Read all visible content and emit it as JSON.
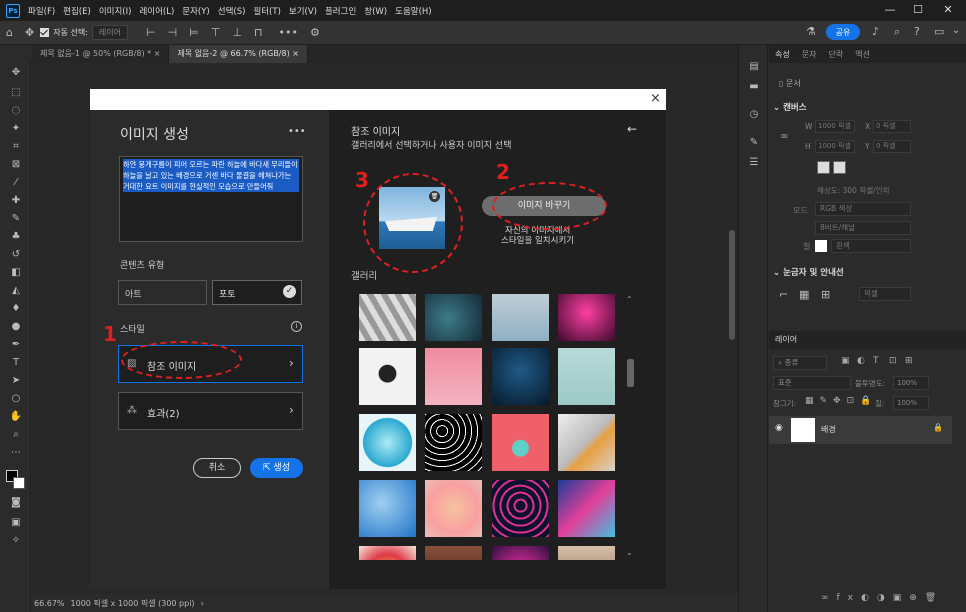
{
  "menu": {
    "app_icon": "Ps",
    "items": [
      "파일(F)",
      "편집(E)",
      "이미지(I)",
      "레이어(L)",
      "문자(Y)",
      "선택(S)",
      "필터(T)",
      "보기(V)",
      "플러그인",
      "창(W)",
      "도움말(H)"
    ]
  },
  "window_controls": {
    "minimize": "—",
    "maximize": "☐",
    "close": "✕"
  },
  "options": {
    "auto_select_label": "자동 선택:",
    "auto_select_value": "레이어",
    "more": "•••",
    "share": "공유"
  },
  "doc_tabs": [
    {
      "label": "제목 없음-1 @ 50% (RGB/8) *",
      "close": "×"
    },
    {
      "label": "제목 없음-2 @ 66.7% (RGB/8)",
      "close": "×"
    }
  ],
  "status": {
    "zoom": "66.67%",
    "info": "1000 픽셀 x 1000 픽셀 (300 ppi)",
    "arrow": "›"
  },
  "properties_panel": {
    "tabs": [
      "속성",
      "문자",
      "단락",
      "액션"
    ],
    "doc_label": "문서",
    "canvas_section": "캔버스",
    "w_label": "W",
    "w_value": "1000 픽셀",
    "h_label": "H",
    "h_value": "1000 픽셀",
    "x_label": "X",
    "x_value": "0 픽셀",
    "y_label": "Y",
    "y_value": "0 픽셀",
    "resolution": "해상도: 300 픽셀/인치",
    "mode_label": "모드",
    "mode_value": "RGB 색상",
    "depth_value": "8비트/채널",
    "fill_label": "칠",
    "fill_value": "흰색",
    "rulers_section": "눈금자 및 안내선",
    "units_value": "픽셀"
  },
  "layers_panel": {
    "title": "레이어",
    "kind": "종류",
    "blend": "표준",
    "opacity_label": "불투명도:",
    "opacity_value": "100%",
    "lock_label": "잠그기:",
    "fill_label": "칠:",
    "fill_value": "100%",
    "layer_name": "배경"
  },
  "dialog": {
    "close": "×",
    "title": "이미지 생성",
    "menu": "•••",
    "prompt": "하얀 뭉게구름이 피어 오르는 파란 하늘에 바다새 무리들이 하늘을 날고 있는 배경으로 거센 바다 물결을 헤쳐나가는 거대한 요트 이미지를 현실적인 모습으로 만들어줘",
    "content_type_label": "콘텐츠 유형",
    "type_art": "아트",
    "type_photo": "포토",
    "style_label": "스타일",
    "info": "i",
    "ref_image_btn": "참조 이미지",
    "effects_btn": "효과(2)",
    "cancel": "취소",
    "generate": "생성",
    "right_title": "참조 이미지",
    "right_subtitle": "갤러리에서 선택하거나 사용자 이미지 선택",
    "back": "←",
    "replace_btn": "이미지 바꾸기",
    "hint_line1": "자신의 이미지에서",
    "hint_line2": "스타일을 일치시키기",
    "gallery_label": "갤러리",
    "delete_icon": "🗑"
  },
  "annotations": {
    "n1": "1",
    "n2": "2",
    "n3": "3"
  },
  "colors": {
    "accent": "#1473e6",
    "annotation": "#e02020",
    "menubar": "#1e1e1e",
    "panel": "#2b2b2b"
  }
}
